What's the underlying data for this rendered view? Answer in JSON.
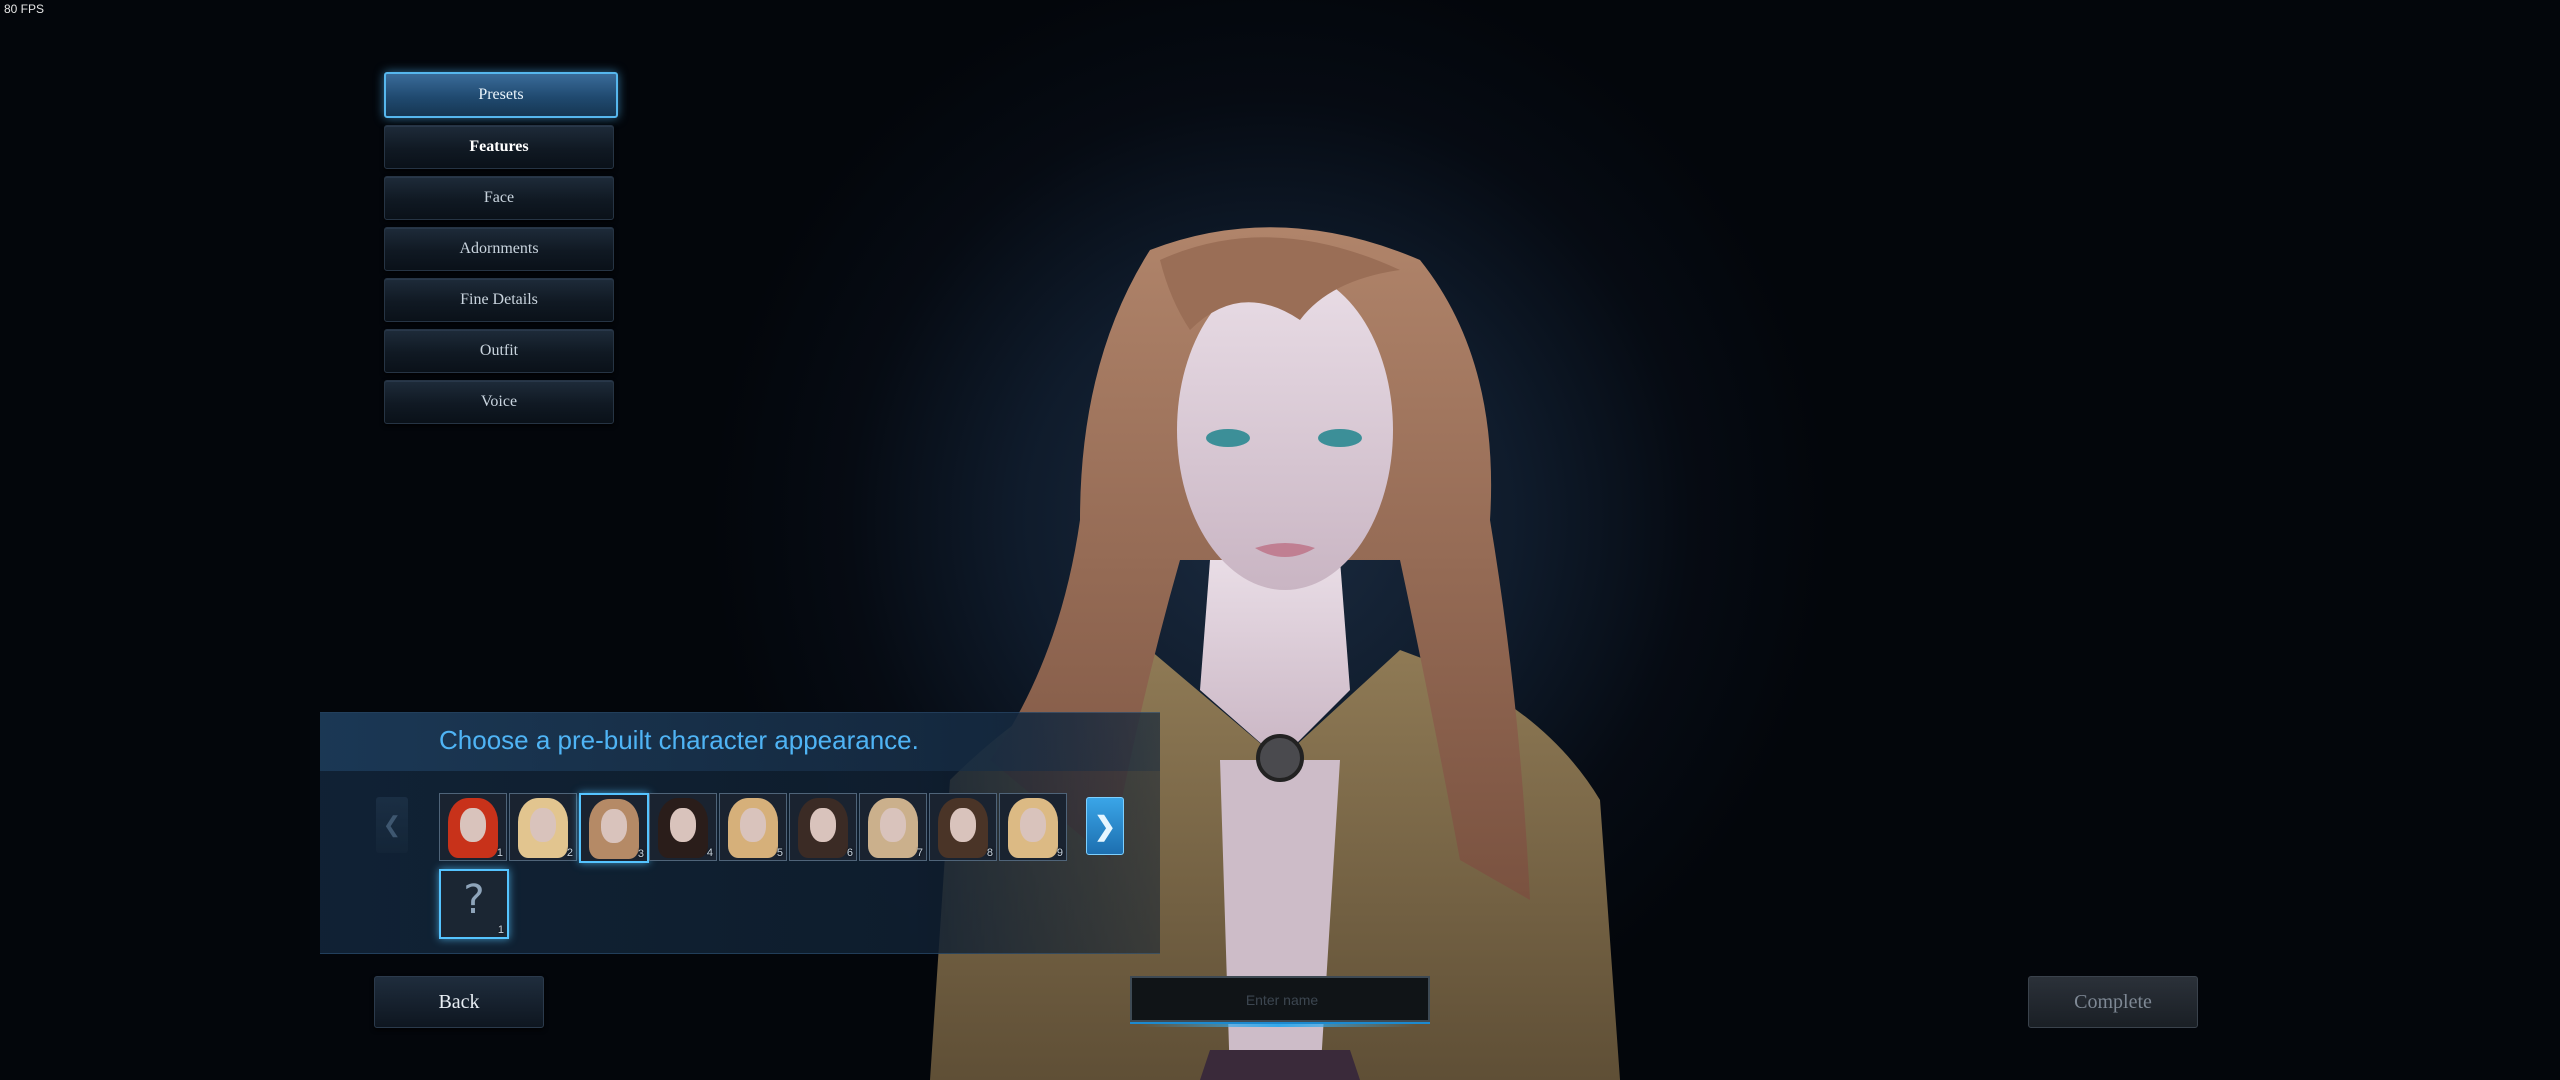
{
  "overlay": {
    "fps_text": "80 FPS"
  },
  "menu": {
    "items": [
      {
        "label": "Presets",
        "active": true
      },
      {
        "label": "Features"
      },
      {
        "label": "Face"
      },
      {
        "label": "Adornments"
      },
      {
        "label": "Fine Details"
      },
      {
        "label": "Outfit"
      },
      {
        "label": "Voice"
      }
    ]
  },
  "presets_panel": {
    "title": "Choose a pre-built character appearance.",
    "thumbnails": [
      {
        "number": "1",
        "hair_color": "#c8321a"
      },
      {
        "number": "2",
        "hair_color": "#e2c58f"
      },
      {
        "number": "3",
        "hair_color": "#b58a66",
        "selected": true
      },
      {
        "number": "4",
        "hair_color": "#2a1d1a"
      },
      {
        "number": "5",
        "hair_color": "#d6b07a"
      },
      {
        "number": "6",
        "hair_color": "#3b2b25"
      },
      {
        "number": "7",
        "hair_color": "#cbb08c"
      },
      {
        "number": "8",
        "hair_color": "#4a3427"
      },
      {
        "number": "9",
        "hair_color": "#dcba84"
      }
    ],
    "random": {
      "number": "1",
      "symbol": "?"
    },
    "nav_left_icon": "chevron-left",
    "nav_right_icon": "chevron-right"
  },
  "footer": {
    "back_label": "Back",
    "name_placeholder": "Enter name",
    "complete_label": "Complete"
  },
  "colors": {
    "accent": "#4fb4f5",
    "selected_border": "#55c4ff",
    "active_menu": "#56b7ee"
  }
}
